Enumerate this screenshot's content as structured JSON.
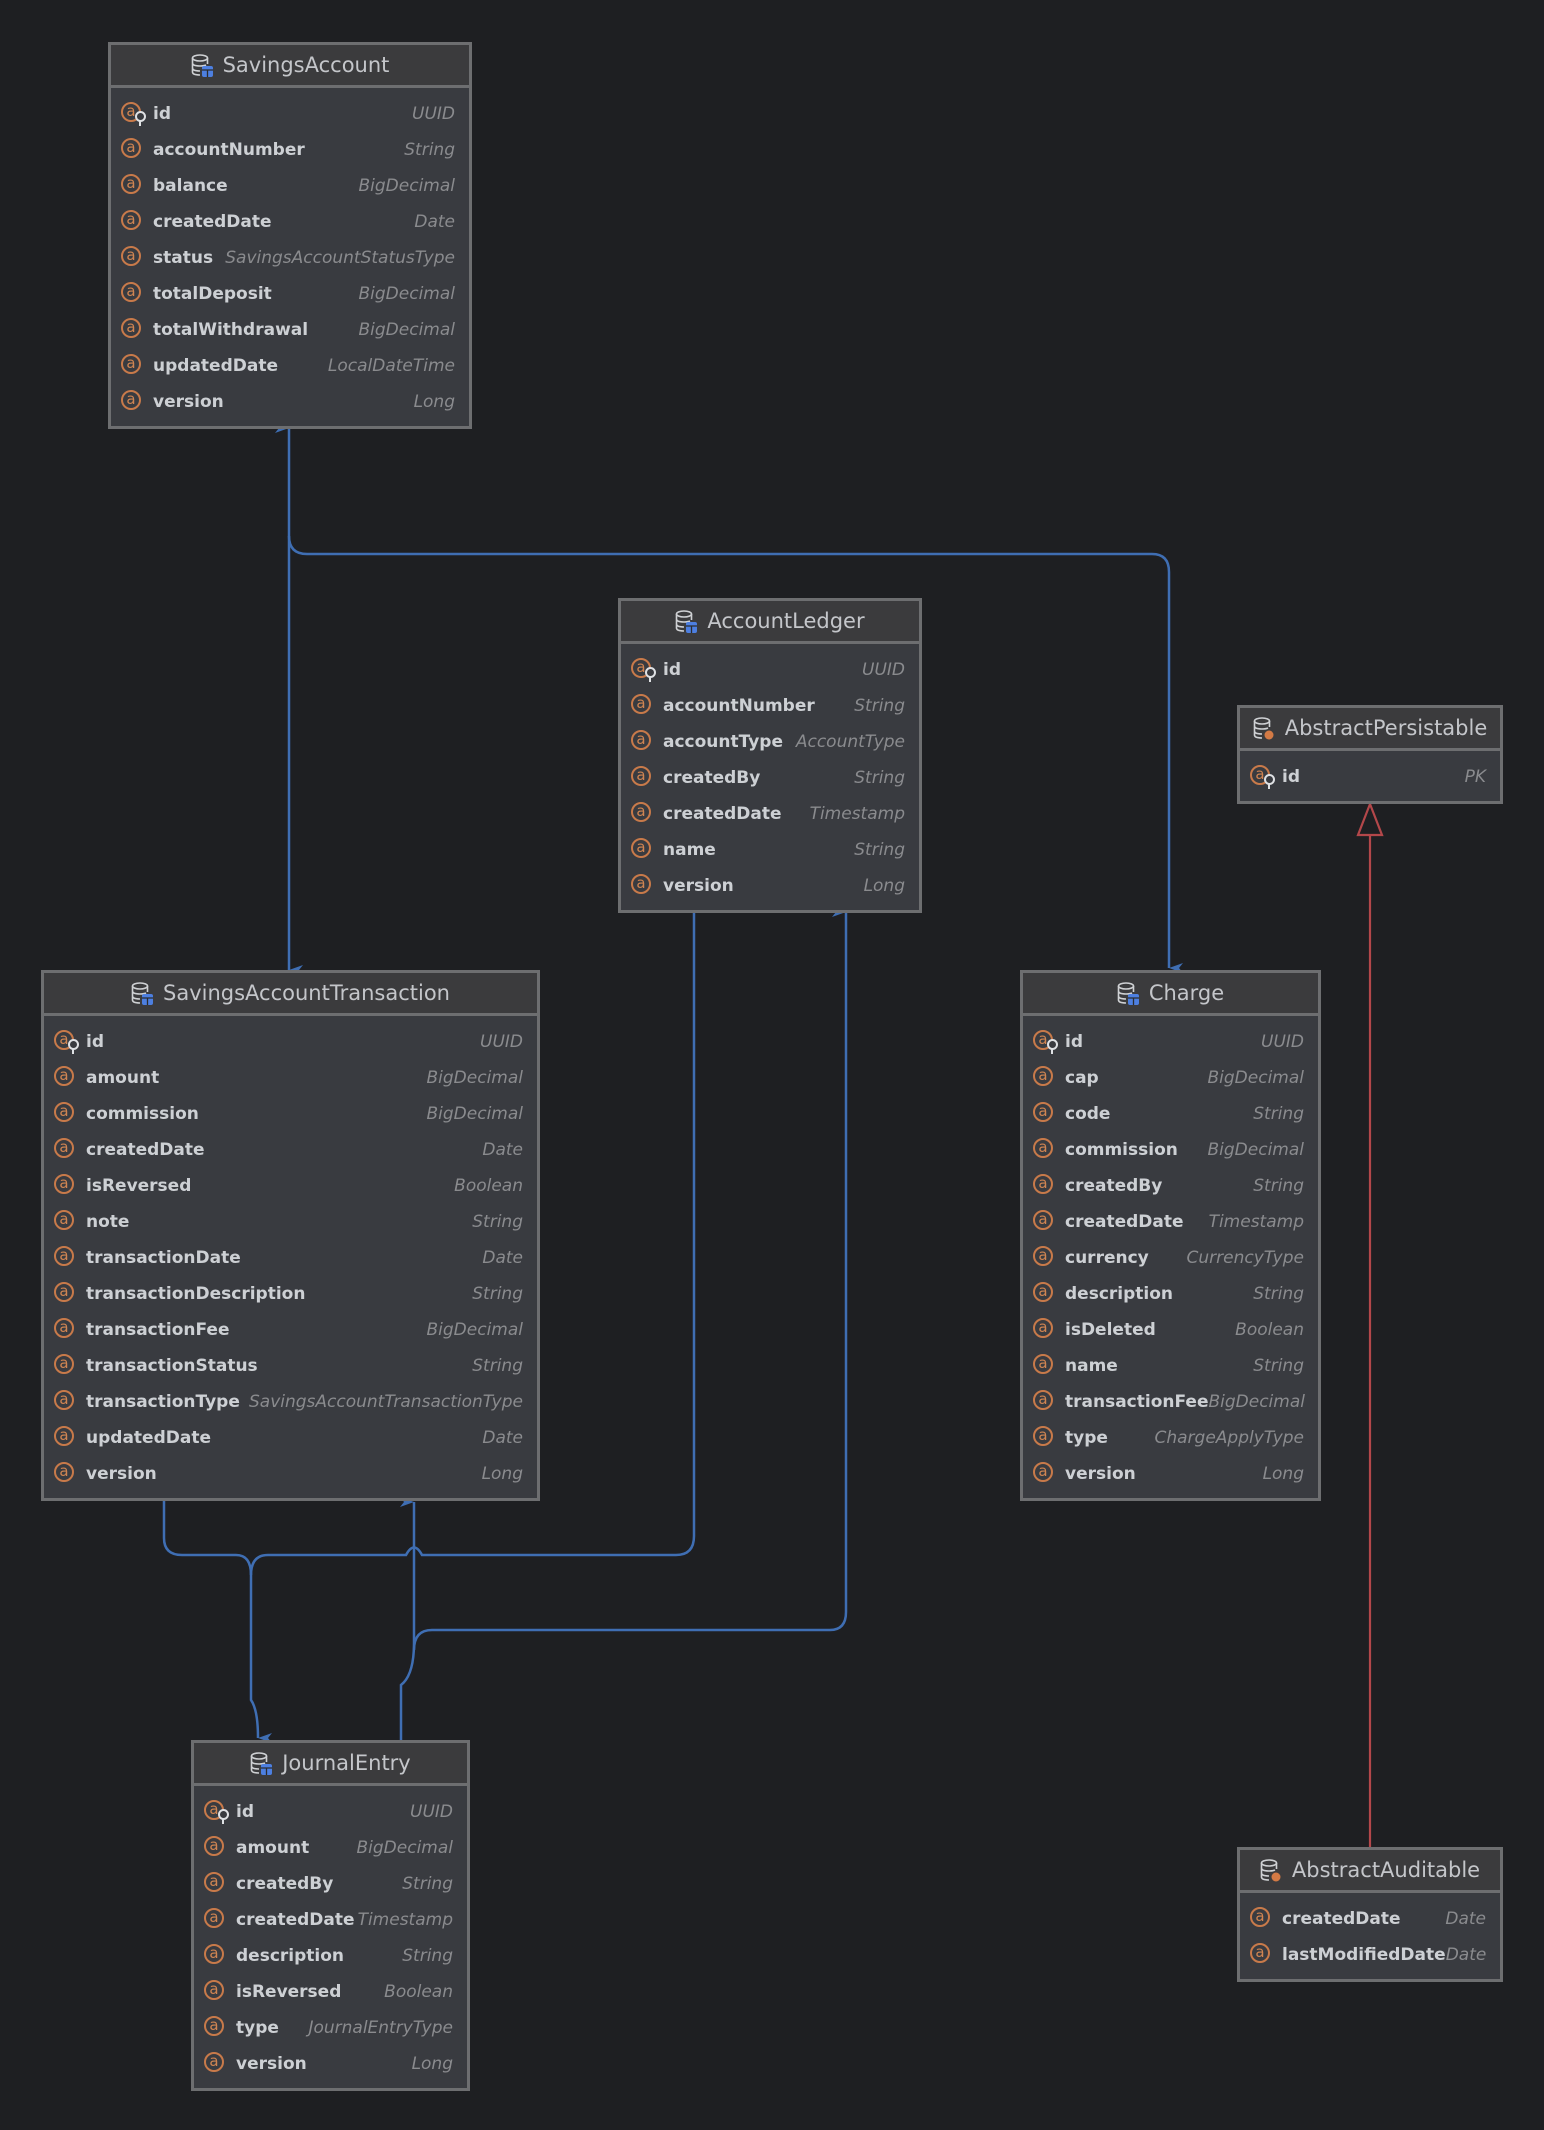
{
  "colors": {
    "background": "#1e1f22",
    "association": "#3f6eb3",
    "inheritance": "#b3474a",
    "attribute_icon": "#c87a4a",
    "entity_badge": "#4d7fe0",
    "abstract_badge": "#d37a45"
  },
  "entities": [
    {
      "id": "SavingsAccount",
      "title": "SavingsAccount",
      "kind": "entity",
      "fields": [
        {
          "name": "id",
          "type": "UUID",
          "pk": true
        },
        {
          "name": "accountNumber",
          "type": "String"
        },
        {
          "name": "balance",
          "type": "BigDecimal"
        },
        {
          "name": "createdDate",
          "type": "Date"
        },
        {
          "name": "status",
          "type": "SavingsAccountStatusType"
        },
        {
          "name": "totalDeposit",
          "type": "BigDecimal"
        },
        {
          "name": "totalWithdrawal",
          "type": "BigDecimal"
        },
        {
          "name": "updatedDate",
          "type": "LocalDateTime"
        },
        {
          "name": "version",
          "type": "Long"
        }
      ]
    },
    {
      "id": "AccountLedger",
      "title": "AccountLedger",
      "kind": "entity",
      "fields": [
        {
          "name": "id",
          "type": "UUID",
          "pk": true
        },
        {
          "name": "accountNumber",
          "type": "String"
        },
        {
          "name": "accountType",
          "type": "AccountType"
        },
        {
          "name": "createdBy",
          "type": "String"
        },
        {
          "name": "createdDate",
          "type": "Timestamp"
        },
        {
          "name": "name",
          "type": "String"
        },
        {
          "name": "version",
          "type": "Long"
        }
      ]
    },
    {
      "id": "AbstractPersistable",
      "title": "AbstractPersistable",
      "kind": "abstract",
      "fields": [
        {
          "name": "id",
          "type": "PK",
          "pk": true
        }
      ]
    },
    {
      "id": "SavingsAccountTransaction",
      "title": "SavingsAccountTransaction",
      "kind": "entity",
      "fields": [
        {
          "name": "id",
          "type": "UUID",
          "pk": true
        },
        {
          "name": "amount",
          "type": "BigDecimal"
        },
        {
          "name": "commission",
          "type": "BigDecimal"
        },
        {
          "name": "createdDate",
          "type": "Date"
        },
        {
          "name": "isReversed",
          "type": "Boolean"
        },
        {
          "name": "note",
          "type": "String"
        },
        {
          "name": "transactionDate",
          "type": "Date"
        },
        {
          "name": "transactionDescription",
          "type": "String"
        },
        {
          "name": "transactionFee",
          "type": "BigDecimal"
        },
        {
          "name": "transactionStatus",
          "type": "String"
        },
        {
          "name": "transactionType",
          "type": "SavingsAccountTransactionType"
        },
        {
          "name": "updatedDate",
          "type": "Date"
        },
        {
          "name": "version",
          "type": "Long"
        }
      ]
    },
    {
      "id": "Charge",
      "title": "Charge",
      "kind": "entity",
      "fields": [
        {
          "name": "id",
          "type": "UUID",
          "pk": true
        },
        {
          "name": "cap",
          "type": "BigDecimal"
        },
        {
          "name": "code",
          "type": "String"
        },
        {
          "name": "commission",
          "type": "BigDecimal"
        },
        {
          "name": "createdBy",
          "type": "String"
        },
        {
          "name": "createdDate",
          "type": "Timestamp"
        },
        {
          "name": "currency",
          "type": "CurrencyType"
        },
        {
          "name": "description",
          "type": "String"
        },
        {
          "name": "isDeleted",
          "type": "Boolean"
        },
        {
          "name": "name",
          "type": "String"
        },
        {
          "name": "transactionFee",
          "type": "BigDecimal"
        },
        {
          "name": "type",
          "type": "ChargeApplyType"
        },
        {
          "name": "version",
          "type": "Long"
        }
      ]
    },
    {
      "id": "JournalEntry",
      "title": "JournalEntry",
      "kind": "entity",
      "fields": [
        {
          "name": "id",
          "type": "UUID",
          "pk": true
        },
        {
          "name": "amount",
          "type": "BigDecimal"
        },
        {
          "name": "createdBy",
          "type": "String"
        },
        {
          "name": "createdDate",
          "type": "Timestamp"
        },
        {
          "name": "description",
          "type": "String"
        },
        {
          "name": "isReversed",
          "type": "Boolean"
        },
        {
          "name": "type",
          "type": "JournalEntryType"
        },
        {
          "name": "version",
          "type": "Long"
        }
      ]
    },
    {
      "id": "AbstractAuditable",
      "title": "AbstractAuditable",
      "kind": "abstract",
      "fields": [
        {
          "name": "createdDate",
          "type": "Date"
        },
        {
          "name": "lastModifiedDate",
          "type": "Date"
        }
      ]
    }
  ],
  "relations": [
    {
      "from": "SavingsAccount",
      "to": "SavingsAccountTransaction",
      "type": "bidirectional-association"
    },
    {
      "from": "SavingsAccount",
      "to": "Charge",
      "type": "association"
    },
    {
      "from": "SavingsAccountTransaction",
      "to": "JournalEntry",
      "type": "association"
    },
    {
      "from": "AccountLedger",
      "to": "JournalEntry",
      "type": "association"
    },
    {
      "from": "JournalEntry",
      "to": "SavingsAccountTransaction",
      "type": "association"
    },
    {
      "from": "JournalEntry",
      "to": "AccountLedger",
      "type": "association"
    },
    {
      "from": "AbstractAuditable",
      "to": "AbstractPersistable",
      "type": "inheritance"
    }
  ]
}
